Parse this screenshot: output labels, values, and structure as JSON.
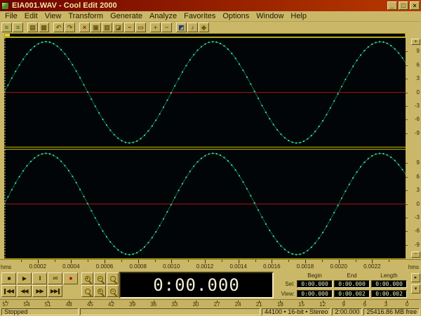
{
  "window": {
    "title": "EIA001.WAV - Cool Edit 2000"
  },
  "menu": {
    "items": [
      "File",
      "Edit",
      "View",
      "Transform",
      "Generate",
      "Analyze",
      "Favorites",
      "Options",
      "Window",
      "Help"
    ]
  },
  "toolbar": {
    "icons": [
      {
        "name": "waveform-view",
        "glyph": "≈",
        "color": "#176b33"
      },
      {
        "name": "multitrack-view",
        "glyph": "≡",
        "color": "#176b33"
      },
      {
        "sep": true
      },
      {
        "name": "open-file",
        "glyph": "▤",
        "color": "#6b5a12"
      },
      {
        "name": "save-file",
        "glyph": "▦",
        "color": "#6b5a12"
      },
      {
        "sep": true
      },
      {
        "name": "undo",
        "glyph": "↶",
        "color": "#705c08"
      },
      {
        "name": "redo",
        "glyph": "↷",
        "color": "#705c08"
      },
      {
        "sep": true
      },
      {
        "name": "cut",
        "glyph": "×",
        "color": "#9a1208"
      },
      {
        "name": "copy",
        "glyph": "▣",
        "color": "#6b5a12"
      },
      {
        "name": "paste",
        "glyph": "▥",
        "color": "#6b5a12"
      },
      {
        "name": "mix-paste",
        "glyph": "◪",
        "color": "#6b5a12"
      },
      {
        "name": "delete",
        "glyph": "−",
        "color": "#9a1208"
      },
      {
        "name": "trim",
        "glyph": "▭",
        "color": "#6b5a12"
      },
      {
        "sep": true
      },
      {
        "name": "zoom-in",
        "glyph": "+",
        "color": "#705c08"
      },
      {
        "name": "zoom-out",
        "glyph": "−",
        "color": "#705c08"
      },
      {
        "sep": true
      },
      {
        "name": "cue-list",
        "glyph": "◩",
        "color": "#1d3a7a"
      },
      {
        "name": "play-list",
        "glyph": "♪",
        "color": "#1d3a7a"
      },
      {
        "name": "settings",
        "glyph": "◆",
        "color": "#6b5a12"
      }
    ]
  },
  "waveform": {
    "frequency_hz": 1000,
    "sample_rate_hz": 44100,
    "view_start_s": 0,
    "view_end_s": 0.0024,
    "amplitude_pct": 93,
    "channels": [
      "left",
      "right"
    ],
    "scale_labels": [
      "9",
      "6",
      "3",
      "0",
      "-3",
      "-6",
      "-9"
    ],
    "colors": {
      "background": "#010508",
      "samples": "#3fe493",
      "line": "#0d6e45",
      "zero_line": "#aa1010",
      "border": "#c9bd00",
      "cursor": "#cfc66a"
    }
  },
  "timeline": {
    "unit": "hms",
    "ticks": [
      "0.0002",
      "0.0004",
      "0.0006",
      "0.0008",
      "0.0010",
      "0.0012",
      "0.0014",
      "0.0016",
      "0.0018",
      "0.0020",
      "0.0022"
    ]
  },
  "transport": {
    "row1": [
      "stop",
      "play",
      "pause",
      "play-looped",
      "record"
    ],
    "row2": [
      "go-to-beginning",
      "rewind",
      "fast-forward",
      "go-to-end"
    ]
  },
  "zoom_controls": [
    "zoom-in-horizontal",
    "zoom-out-horizontal",
    "zoom-full",
    "zoom-to-selection",
    "zoom-in-vertical",
    "zoom-out-vertical"
  ],
  "time_display": {
    "value": "0:00.000"
  },
  "selection_panel": {
    "columns": [
      "Begin",
      "End",
      "Length"
    ],
    "rows": [
      {
        "label": "Sel:",
        "begin": "0:00.000",
        "end": "0:00.000",
        "length": "0:00.000"
      },
      {
        "label": "View:",
        "begin": "0:00.000",
        "end": "0:00.002",
        "length": "0:00.002"
      }
    ]
  },
  "level_meter": {
    "labels": [
      "57",
      "54",
      "51",
      "48",
      "45",
      "42",
      "39",
      "36",
      "33",
      "30",
      "27",
      "24",
      "21",
      "18",
      "15",
      "12",
      "9",
      "6",
      "3",
      "0"
    ]
  },
  "status_bar": {
    "state": "Stopped",
    "format": "44100 • 16-bit • Stereo",
    "length": "2:00.000",
    "free_space": "25416.86 MB free"
  }
}
